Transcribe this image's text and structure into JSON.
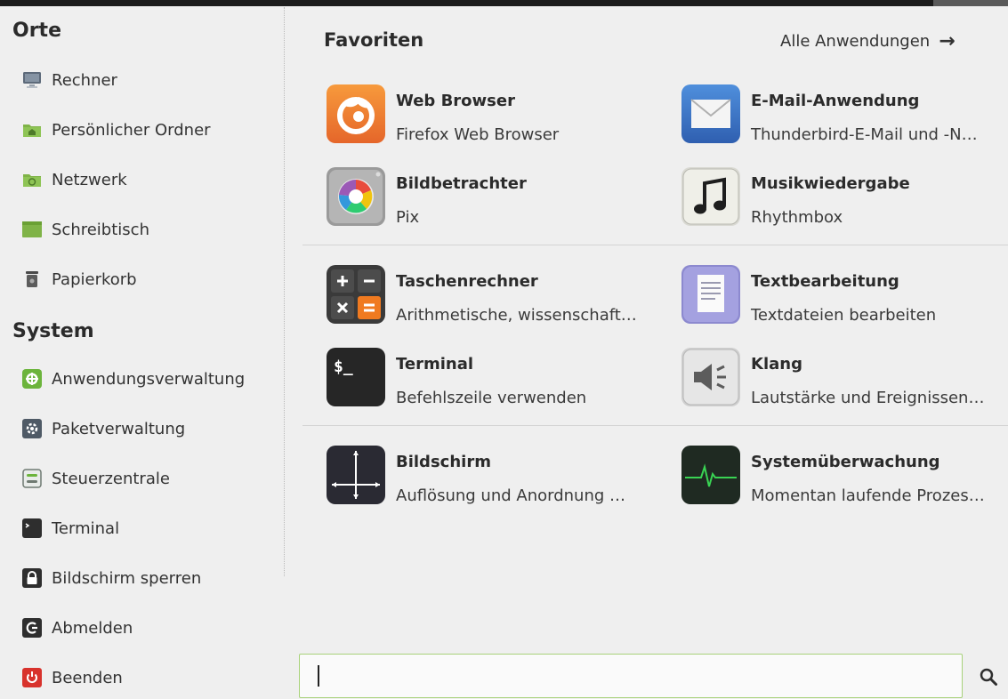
{
  "places": {
    "title": "Orte",
    "items": [
      {
        "label": "Rechner",
        "icon": "computer-icon"
      },
      {
        "label": "Persönlicher Ordner",
        "icon": "home-folder-icon"
      },
      {
        "label": "Netzwerk",
        "icon": "network-folder-icon"
      },
      {
        "label": "Schreibtisch",
        "icon": "desktop-folder-icon"
      },
      {
        "label": "Papierkorb",
        "icon": "trash-icon"
      }
    ]
  },
  "system": {
    "title": "System",
    "items": [
      {
        "label": "Anwendungsverwaltung",
        "icon": "software-manager-icon"
      },
      {
        "label": "Paketverwaltung",
        "icon": "package-manager-icon"
      },
      {
        "label": "Steuerzentrale",
        "icon": "control-center-icon"
      },
      {
        "label": "Terminal",
        "icon": "terminal-icon"
      },
      {
        "label": "Bildschirm sperren",
        "icon": "lock-icon"
      },
      {
        "label": "Abmelden",
        "icon": "logout-icon"
      },
      {
        "label": "Beenden",
        "icon": "power-icon"
      }
    ]
  },
  "favorites": {
    "title": "Favoriten",
    "all_apps_label": "Alle Anwendungen",
    "apps": [
      {
        "name": "Web Browser",
        "desc": "Firefox Web Browser",
        "icon": "firefox-icon"
      },
      {
        "name": "E-Mail-Anwendung",
        "desc": "Thunderbird-E-Mail und -N…",
        "icon": "mail-icon"
      },
      {
        "name": "Bildbetrachter",
        "desc": "Pix",
        "icon": "image-viewer-icon"
      },
      {
        "name": "Musikwiedergabe",
        "desc": "Rhythmbox",
        "icon": "music-icon"
      },
      {
        "name": "Taschenrechner",
        "desc": "Arithmetische, wissenschaft…",
        "icon": "calculator-icon"
      },
      {
        "name": "Textbearbeitung",
        "desc": "Textdateien bearbeiten",
        "icon": "text-editor-icon"
      },
      {
        "name": "Terminal",
        "desc": "Befehlszeile verwenden",
        "icon": "terminal-app-icon"
      },
      {
        "name": "Klang",
        "desc": "Lautstärke und Ereignissen…",
        "icon": "sound-icon"
      },
      {
        "name": "Bildschirm",
        "desc": "Auflösung und Anordnung …",
        "icon": "display-icon"
      },
      {
        "name": "Systemüberwachung",
        "desc": "Momentan laufende Prozes…",
        "icon": "system-monitor-icon"
      }
    ]
  },
  "search": {
    "value": "",
    "placeholder": ""
  }
}
